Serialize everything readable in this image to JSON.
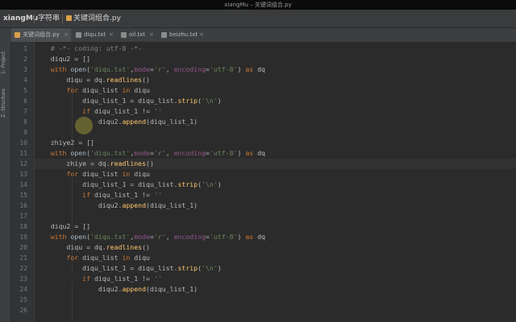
{
  "window": {
    "title": "xiangMu – 关键词组合.py"
  },
  "navbar": {
    "project": "xiangMu",
    "folder": "字符串",
    "file": "关键词组合.py"
  },
  "tabs": [
    {
      "label": "关键词组合.py",
      "active": true,
      "icon_color": "#d9a04a"
    },
    {
      "label": "diqu.txt",
      "active": false,
      "icon_color": "#8b8b8b"
    },
    {
      "label": "oil.txt",
      "active": false,
      "icon_color": "#8b8b8b"
    },
    {
      "label": "beizhu.txt",
      "active": false,
      "icon_color": "#8b8b8b"
    }
  ],
  "sidebar": {
    "project_tab": "1: Project",
    "structure_tab": "Z: Structure"
  },
  "editor": {
    "current_line": 12,
    "line_numbers": [
      "1",
      "2",
      "3",
      "4",
      "5",
      "6",
      "7",
      "8",
      "9",
      "10",
      "11",
      "12",
      "13",
      "14",
      "15",
      "16",
      "17",
      "18",
      "19",
      "20",
      "21",
      "22",
      "23",
      "24",
      "25",
      "26"
    ],
    "lines": [
      "    # -*- coding: utf-8 -*-",
      "    diqu2 = []",
      "    with open('diqu.txt',mode='r', encoding='utf-8') as dq",
      "        diqu = dq.readlines()",
      "        for diqu_list in diqu",
      "            diqu_list_1 = diqu_list.strip('\\n')",
      "            if diqu_list_1 != ''",
      "                diqu2.append(diqu_list_1)",
      "",
      "    zhiye2 = []",
      "    with open('diqu.txt',mode='r', encoding='utf-8') as dq",
      "        zhiye = dq.readlines()",
      "        for diqu_list in diqu",
      "            diqu_list_1 = diqu_list.strip('\\n')",
      "            if diqu_list_1 != ''",
      "                diqu2.append(diqu_list_1)",
      "",
      "    diqu2 = []",
      "    with open('diqu.txt',mode='r', encoding='utf-8') as dq",
      "        diqu = dq.readlines()",
      "        for diqu_list in diqu",
      "            diqu_list_1 = diqu_list.strip('\\n')",
      "            if diqu_list_1 != ''",
      "                diqu2.append(diqu_list_1)",
      "",
      ""
    ]
  }
}
